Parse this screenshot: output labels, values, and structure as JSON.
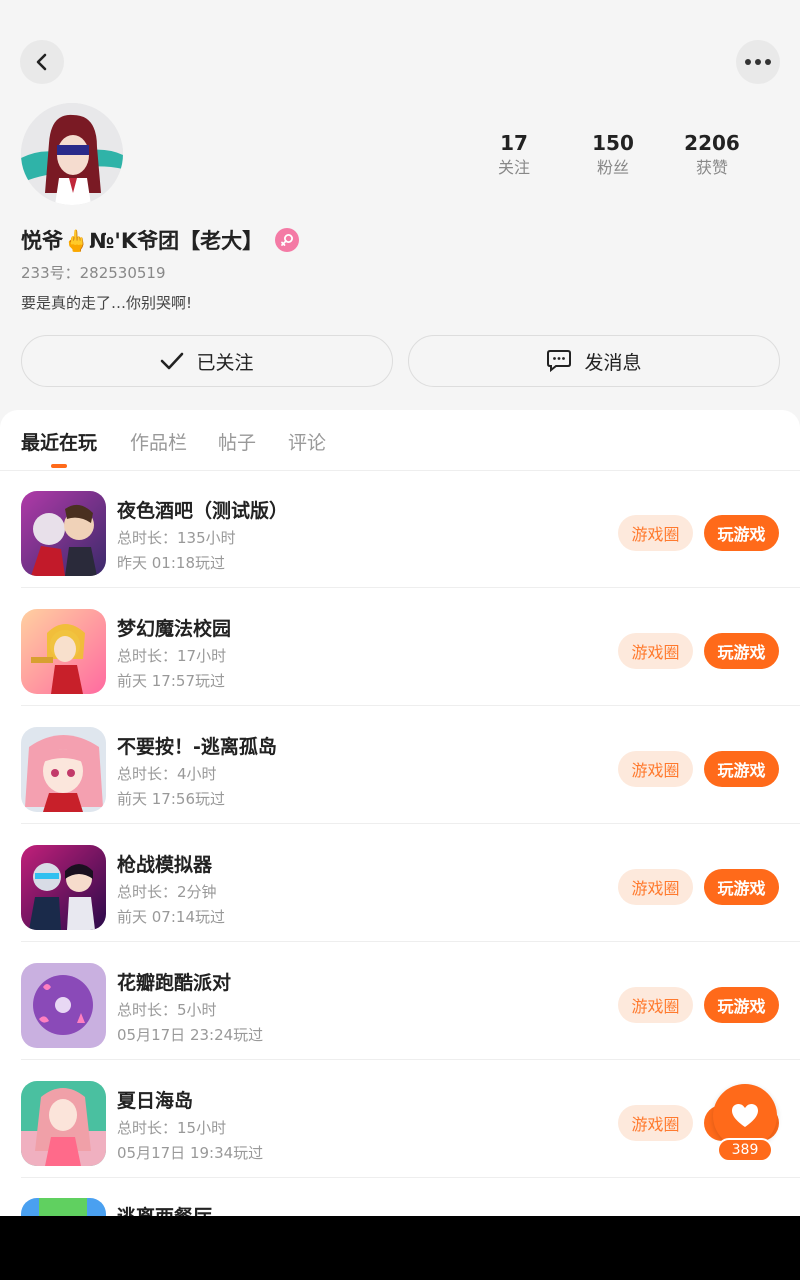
{
  "profile": {
    "name": "悦爷🖕№'K爷团【老大】",
    "uid": "233号：282530519",
    "bio": "要是真的走了…你别哭啊!",
    "stats": [
      {
        "num": "17",
        "label": "关注"
      },
      {
        "num": "150",
        "label": "粉丝"
      },
      {
        "num": "2206",
        "label": "获赞"
      }
    ],
    "follow_label": "已关注",
    "message_label": "发消息"
  },
  "tabs": [
    "最近在玩",
    "作品栏",
    "帖子",
    "评论"
  ],
  "games": [
    {
      "title": "夜色酒吧（测试版）",
      "duration": "总时长：135小时",
      "last": "昨天 01:18玩过"
    },
    {
      "title": "梦幻魔法校园",
      "duration": "总时长：17小时",
      "last": "前天 17:57玩过"
    },
    {
      "title": "不要按！-逃离孤岛",
      "duration": "总时长：4小时",
      "last": "前天 17:56玩过"
    },
    {
      "title": "枪战模拟器",
      "duration": "总时长：2分钟",
      "last": "前天 07:14玩过"
    },
    {
      "title": "花瓣跑酷派对",
      "duration": "总时长：5小时",
      "last": "05月17日 23:24玩过"
    },
    {
      "title": "夏日海岛",
      "duration": "总时长：15小时",
      "last": "05月17日 19:34玩过"
    }
  ],
  "partial_game_title": "逃离西餐厅",
  "circle_label": "游戏圈",
  "play_label": "玩游戏",
  "like_count": "389",
  "colors": {
    "accent": "#ff6a1a",
    "accent_soft": "#fde9dc",
    "gender": "#f47aa5"
  }
}
